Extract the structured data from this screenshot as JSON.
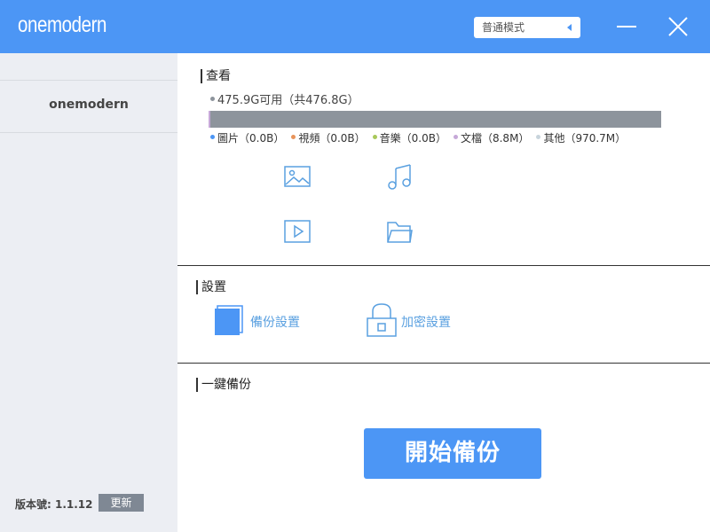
{
  "app": {
    "logo": "onemodern",
    "mode_select": "普通模式"
  },
  "sidebar": {
    "username": "onemodern",
    "version": "版本號: 1.1.12",
    "update_label": "更新"
  },
  "view": {
    "title": "查看",
    "capacity": "475.9G可用（共476.8G）",
    "legend": [
      {
        "label": "圖片（0.0B）",
        "color": "#4c96f5"
      },
      {
        "label": "視頻（0.0B）",
        "color": "#e8945a"
      },
      {
        "label": "音樂（0.0B）",
        "color": "#a8c85a"
      },
      {
        "label": "文檔（8.8M）",
        "color": "#c6a8d8"
      },
      {
        "label": "其他（970.7M）",
        "color": "#c8d4dc"
      }
    ],
    "categories": [
      {
        "icon": "image-icon"
      },
      {
        "icon": "music-icon"
      },
      {
        "icon": "video-icon"
      },
      {
        "icon": "folder-icon"
      }
    ]
  },
  "settings": {
    "title": "設置",
    "backup_settings": "備份設置",
    "encryption_settings": "加密設置"
  },
  "backup": {
    "title": "一鍵備份",
    "start_label": "開始備份"
  },
  "colors": {
    "accent": "#4c96f5",
    "sidebar_bg": "#eceef3",
    "bar_gray": "#8d949c"
  }
}
